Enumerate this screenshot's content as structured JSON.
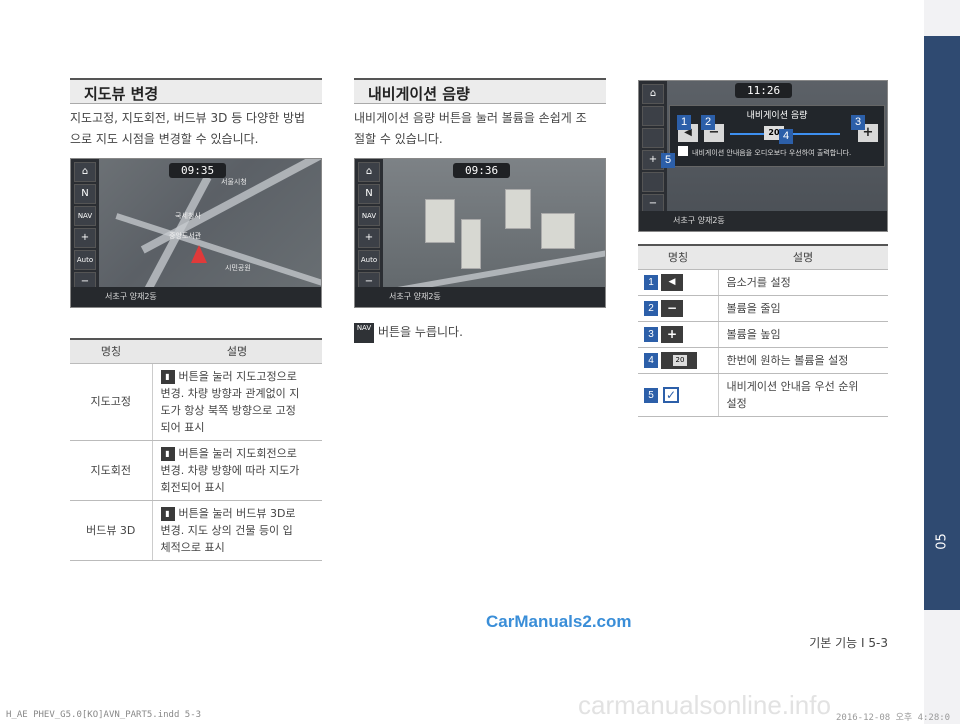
{
  "side_tab": {
    "number": "05"
  },
  "left": {
    "title": "지도뷰 변경",
    "intro_line1": "지도고정, 지도회전, 버드뷰 3D 등 다양한 방법",
    "intro_line2": "으로 지도 시점을 변경할 수 있습니다.",
    "screen": {
      "clock": "09:35",
      "location": "서초구 양재2동",
      "side_labels": [
        "⌂",
        "N",
        "NAV",
        "+",
        "Auto",
        "−"
      ],
      "poi": [
        "서울시청",
        "국세청사",
        "중앙도서관",
        "시민공원"
      ]
    },
    "table": {
      "headers": [
        "명칭",
        "설명"
      ],
      "rows": [
        {
          "name": "지도고정",
          "lines": [
            "버튼을 눌러 지도고정으로",
            "변경. 차량 방향과 관계없이 지",
            "도가 항상 북쪽 방향으로 고정",
            "되어 표시"
          ]
        },
        {
          "name": "지도회전",
          "lines": [
            "버튼을 눌러 지도회전으로",
            "변경. 차량 방향에 따라 지도가",
            "회전되어 표시"
          ]
        },
        {
          "name": "버드뷰 3D",
          "lines": [
            "버튼을 눌러 버드뷰 3D로",
            "변경. 지도 상의 건물 등이 입",
            "체적으로 표시"
          ]
        }
      ]
    }
  },
  "middle": {
    "title": "내비게이션 음량",
    "intro_line1": "내비게이션 음량 버튼을 눌러 볼륨을 손쉽게 조",
    "intro_line2": "절할 수 있습니다.",
    "screen": {
      "clock": "09:36",
      "location": "서초구 양재2동",
      "side_labels": [
        "⌂",
        "N",
        "NAV",
        "+",
        "Auto",
        "−"
      ]
    },
    "step_icon": "NAV",
    "step_text": "버튼을 누릅니다."
  },
  "right": {
    "screen": {
      "clock": "11:26",
      "popup_title": "내비게이션 음량",
      "volume_value": "20",
      "checkbox_text": "내비게이션 안내음을 오디오보다 우선하여 출력합니다.",
      "location": "서초구 양재2동",
      "callouts": [
        "1",
        "2",
        "3",
        "4",
        "5"
      ]
    },
    "table": {
      "headers": [
        "명칭",
        "설명"
      ],
      "rows": [
        {
          "num": "1",
          "icon": "speaker-icon",
          "desc": "음소거를 설정"
        },
        {
          "num": "2",
          "icon": "minus-icon",
          "desc": "볼륨을 줄임"
        },
        {
          "num": "3",
          "icon": "plus-icon",
          "desc": "볼륨을 높임"
        },
        {
          "num": "4",
          "icon": "volume-bar-icon",
          "icon_text": "20",
          "desc": "한번에 원하는 볼륨을 설정"
        },
        {
          "num": "5",
          "icon": "checkbox-icon",
          "desc_line1": "내비게이션 안내음 우선 순위",
          "desc_line2": "설정"
        }
      ]
    }
  },
  "footer": {
    "page": "기본 기능 I 5-3",
    "watermark": "CarManuals2.com",
    "print_info": "H_AE PHEV_G5.0[KO]AVN_PART5.indd   5-3",
    "print_date": "2016-12-08  오후 4:28:0",
    "watermark2": "carmanualsonline.info"
  }
}
